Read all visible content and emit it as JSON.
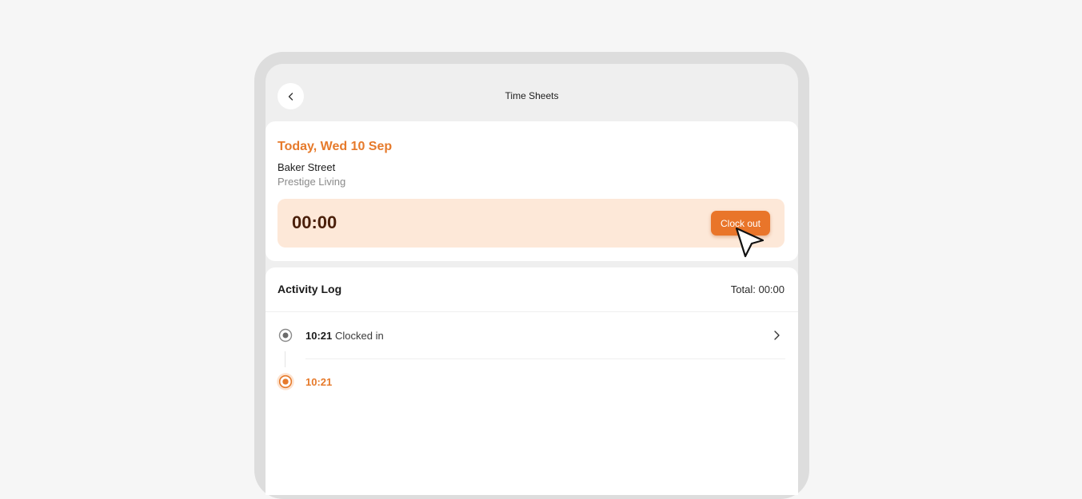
{
  "header": {
    "title": "Time Sheets",
    "back_icon": "chevron-left-icon"
  },
  "today": {
    "date_label": "Today, Wed 10 Sep",
    "site_name": "Baker Street",
    "site_company": "Prestige Living",
    "timer": "00:00",
    "clock_out_label": "Clock out"
  },
  "activity": {
    "title": "Activity Log",
    "total_label": "Total: 00:00",
    "entries": [
      {
        "time": "10:21",
        "label": "Clocked in",
        "status": "done"
      },
      {
        "time": "10:21",
        "label": "",
        "status": "active"
      }
    ]
  },
  "colors": {
    "accent": "#e67a2b",
    "timer_bg": "#fde8d8",
    "page_bg": "#f6f6f6"
  }
}
